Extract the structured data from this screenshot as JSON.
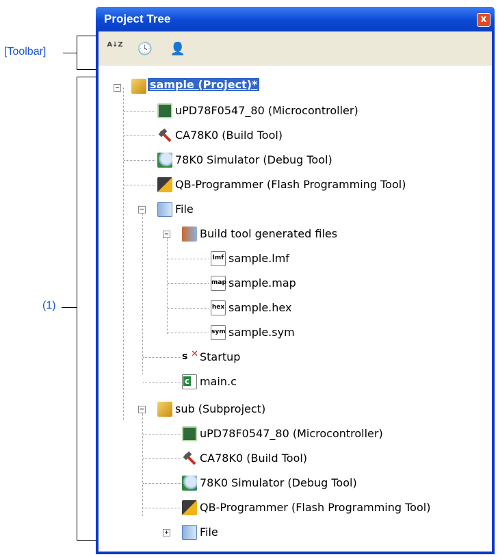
{
  "callouts": {
    "toolbar": "[Toolbar]",
    "tree": "(1)"
  },
  "window": {
    "title": "Project Tree",
    "close_glyph": "x"
  },
  "toolbar": {
    "buttons": [
      {
        "icon": "sort-az-icon",
        "glyph": "A↓Z"
      },
      {
        "icon": "clock-icon",
        "glyph": "🕓"
      },
      {
        "icon": "person-icon",
        "glyph": "👤"
      }
    ]
  },
  "tree": {
    "root": {
      "label": "sample (Project)*",
      "icon": "project-icon",
      "expander": "−"
    },
    "items": [
      {
        "label": "uPD78F0547_80 (Microcontroller)",
        "icon": "microcontroller-icon"
      },
      {
        "label": "CA78K0 (Build Tool)",
        "icon": "build-tool-icon"
      },
      {
        "label": "78K0 Simulator (Debug Tool)",
        "icon": "debug-tool-icon"
      },
      {
        "label": "QB-Programmer (Flash Programming Tool)",
        "icon": "flash-tool-icon"
      },
      {
        "label": "File",
        "icon": "folder-icon",
        "expander": "−"
      },
      {
        "label": "Build tool generated files",
        "icon": "generated-files-folder-icon",
        "expander": "−"
      },
      {
        "label": "sample.lmf",
        "icon": "lmf-file-icon",
        "tag": "lmf"
      },
      {
        "label": "sample.map",
        "icon": "map-file-icon",
        "tag": "map"
      },
      {
        "label": "sample.hex",
        "icon": "hex-file-icon",
        "tag": "hex"
      },
      {
        "label": "sample.sym",
        "icon": "sym-file-icon",
        "tag": "sym"
      },
      {
        "label": "Startup",
        "icon": "startup-icon",
        "tag": "s"
      },
      {
        "label": "main.c",
        "icon": "c-file-icon",
        "tag": "c"
      },
      {
        "label": "sub (Subproject)",
        "icon": "subproject-icon",
        "expander": "−"
      },
      {
        "label": "uPD78F0547_80 (Microcontroller)",
        "icon": "microcontroller-icon"
      },
      {
        "label": "CA78K0 (Build Tool)",
        "icon": "build-tool-icon"
      },
      {
        "label": "78K0 Simulator (Debug Tool)",
        "icon": "debug-tool-icon"
      },
      {
        "label": "QB-Programmer (Flash Programming Tool)",
        "icon": "flash-tool-icon"
      },
      {
        "label": "File",
        "icon": "folder-icon",
        "expander": "+"
      }
    ]
  }
}
